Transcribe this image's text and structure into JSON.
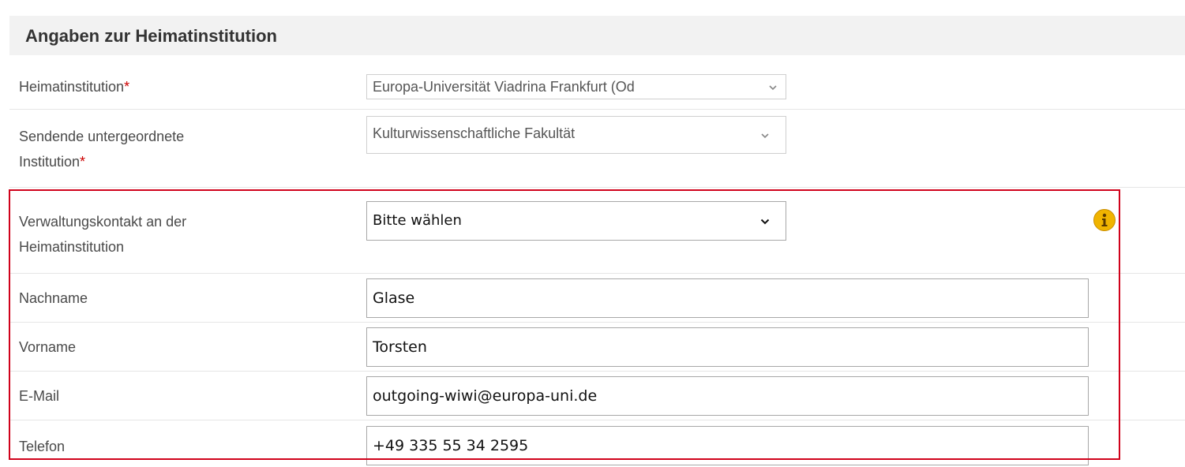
{
  "section": {
    "title": "Angaben zur Heimatinstitution"
  },
  "fields": {
    "home_institution": {
      "label": "Heimatinstitution",
      "required_mark": "*",
      "value": "Europa-Universität Viadrina Frankfurt (Od"
    },
    "sending_sub_institution": {
      "label_line1": "Sendende untergeordnete",
      "label_line2": "Institution",
      "required_mark": "*",
      "value": "Kulturwissenschaftliche Fakultät"
    },
    "admin_contact": {
      "label_line1": "Verwaltungskontakt an der",
      "label_line2": "Heimatinstitution",
      "value": "Bitte wählen",
      "info_icon": "info-icon"
    },
    "last_name": {
      "label": "Nachname",
      "value": "Glase"
    },
    "first_name": {
      "label": "Vorname",
      "value": "Torsten"
    },
    "email": {
      "label": "E-Mail",
      "value": "outgoing-wiwi@europa-uni.de"
    },
    "phone": {
      "label": "Telefon",
      "value": "+49 335 55 34 2595"
    }
  },
  "colors": {
    "header_bg": "#f2f2f2",
    "required": "#cc0000",
    "highlight_border": "#d0021b",
    "info_icon": "#f0b400"
  }
}
